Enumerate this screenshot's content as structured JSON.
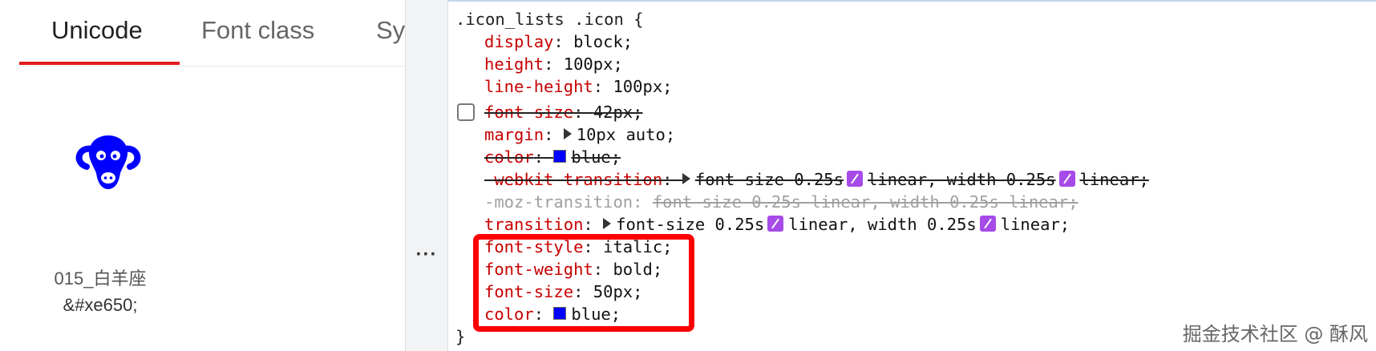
{
  "tabs": [
    {
      "label": "Unicode",
      "active": true
    },
    {
      "label": "Font class",
      "active": false
    },
    {
      "label": "Sy",
      "active": false
    }
  ],
  "icon": {
    "glyph_icon": "ram-head-icon",
    "color": "#0000ff",
    "name": "015_白羊座",
    "code": "&#xe650;"
  },
  "splitter": {
    "dots": "···"
  },
  "css_rule": {
    "selector": ".icon_lists .icon {",
    "closing_brace": "}",
    "declarations": [
      {
        "prop": "display",
        "value": "block;"
      },
      {
        "prop": "height",
        "value": "100px;"
      },
      {
        "prop": "line-height",
        "value": "100px;"
      },
      {
        "prop": "font-size",
        "value": "42px;",
        "struck": true,
        "checkbox": true
      },
      {
        "prop": "margin",
        "value": "10px auto;",
        "expandable": true
      },
      {
        "prop": "color",
        "value": "blue;",
        "struck": true,
        "swatch": "#0000ff"
      },
      {
        "prop": "-webkit-transition",
        "value_parts": [
          "font-size 0.25s",
          "linear, width 0.25s",
          "linear;"
        ],
        "struck": true,
        "expandable": true
      },
      {
        "prop": "-moz-transition",
        "value": "font-size 0.25s linear, width 0.25s linear;",
        "invalid": true
      },
      {
        "prop": "transition",
        "value_parts": [
          "font-size 0.25s",
          "linear, width 0.25s",
          "linear;"
        ],
        "expandable": true
      },
      {
        "prop": "font-style",
        "value": "italic;"
      },
      {
        "prop": "font-weight",
        "value": "bold;"
      },
      {
        "prop": "font-size",
        "value": "50px;"
      },
      {
        "prop": "color",
        "value": "blue;",
        "swatch": "#0000ff"
      }
    ]
  },
  "highlight_color": "#ff0000",
  "watermark": "掘金技术社区 @ 酥风"
}
